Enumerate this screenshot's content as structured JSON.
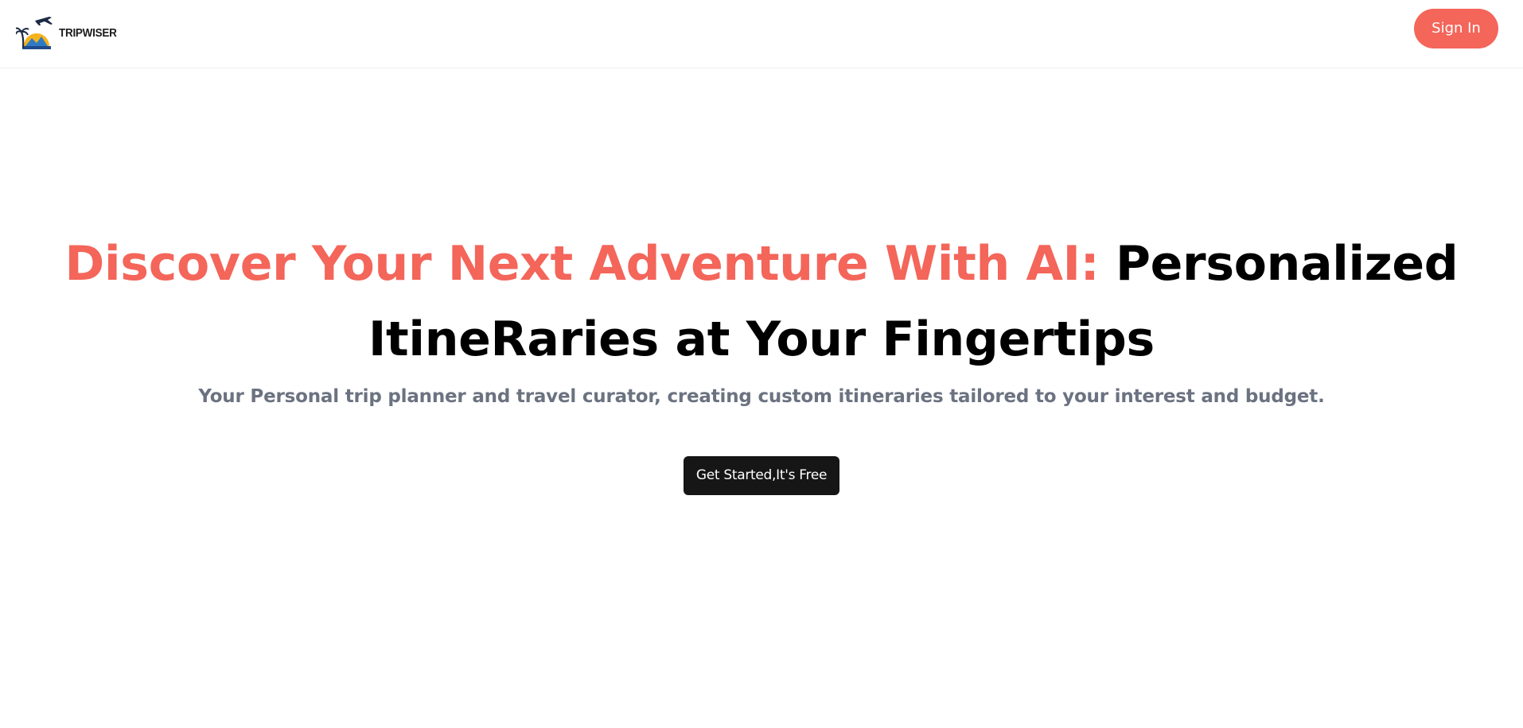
{
  "header": {
    "logo_text": "TRIPWISER",
    "logo_icon": "plane-palm-sunset-icon",
    "signin_label": "Sign In"
  },
  "hero": {
    "title_accent": "Discover Your Next Adventure With AI:",
    "title_rest": "Personalized ItineRaries at Your Fingertips",
    "subtitle": "Your Personal trip planner and travel curator, creating custom itineraries tailored to your interest and budget.",
    "cta_label": "Get Started,It's Free"
  },
  "colors": {
    "accent": "#f4655a",
    "cta_background": "#161616",
    "subtitle": "#6b7280",
    "title": "#000000"
  }
}
